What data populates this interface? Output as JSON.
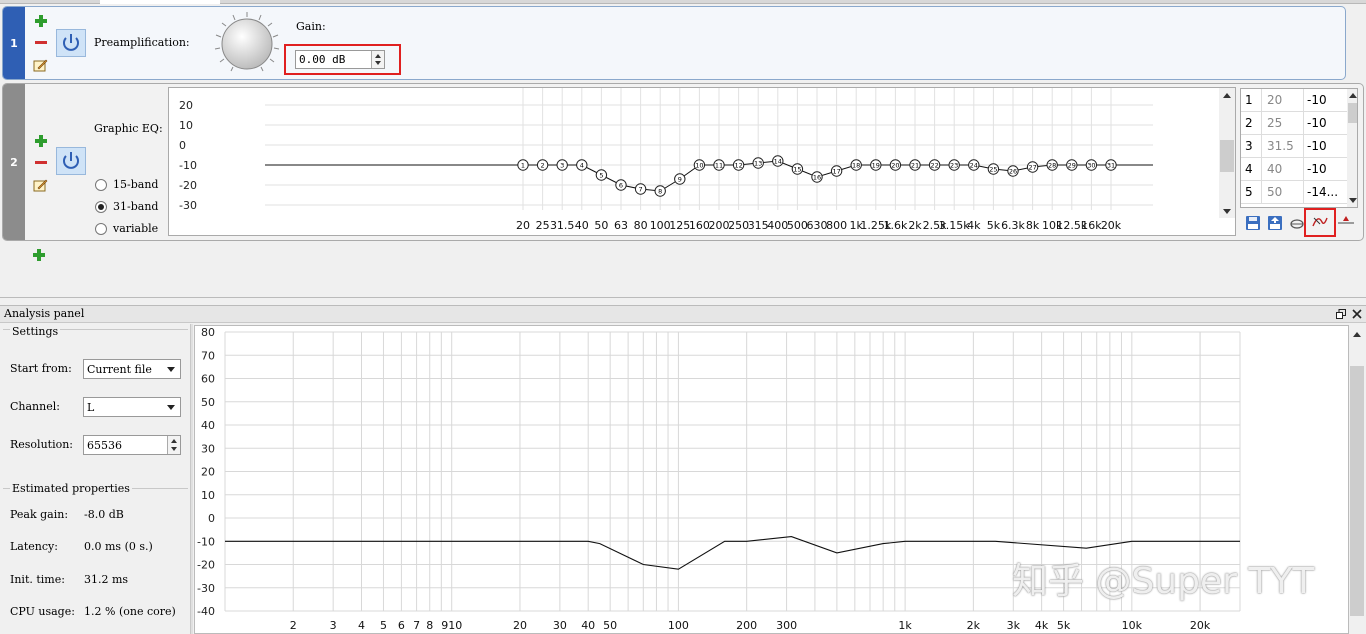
{
  "preamp": {
    "index": "1",
    "label": "Preamplification:",
    "gain_label": "Gain:",
    "gain_value": "0.00 dB"
  },
  "eq": {
    "index": "2",
    "label": "Graphic EQ:",
    "modes": [
      "15-band",
      "31-band",
      "variable"
    ],
    "selected_mode": "31-band",
    "y_ticks": [
      "20",
      "10",
      "0",
      "-10",
      "-20",
      "-30"
    ],
    "freq_labels": [
      "20",
      "25",
      "31.5",
      "40",
      "50",
      "63",
      "80",
      "100",
      "125",
      "160",
      "200",
      "250",
      "315",
      "400",
      "500",
      "630",
      "800",
      "1k",
      "1.25k",
      "1.6k",
      "2k",
      "2.5k",
      "3.15k",
      "4k",
      "5k",
      "6.3k",
      "8k",
      "10k",
      "12.5k",
      "16k",
      "20k"
    ],
    "band_gains": [
      -10,
      -10,
      -10,
      -10,
      -15,
      -20,
      -22,
      -23,
      -17,
      -10,
      -10,
      -10,
      -9,
      -8,
      -12,
      -16,
      -13,
      -10,
      -10,
      -10,
      -10,
      -10,
      -10,
      -10,
      -12,
      -13,
      -11,
      -10,
      -10,
      -10,
      -10
    ],
    "table": [
      {
        "n": "1",
        "f": "20",
        "g": "-10"
      },
      {
        "n": "2",
        "f": "25",
        "g": "-10"
      },
      {
        "n": "3",
        "f": "31.5",
        "g": "-10"
      },
      {
        "n": "4",
        "f": "40",
        "g": "-10"
      },
      {
        "n": "5",
        "f": "50",
        "g": "-14..."
      }
    ]
  },
  "analysis": {
    "title": "Analysis panel",
    "settings_title": "Settings",
    "start_from_label": "Start from:",
    "start_from_value": "Current file",
    "channel_label": "Channel:",
    "channel_value": "L",
    "resolution_label": "Resolution:",
    "resolution_value": "65536",
    "estimated_title": "Estimated properties",
    "props": [
      {
        "label": "Peak gain:",
        "value": "-8.0 dB"
      },
      {
        "label": "Latency:",
        "value": "0.0 ms (0 s.)"
      },
      {
        "label": "Init. time:",
        "value": "31.2 ms"
      },
      {
        "label": "CPU usage:",
        "value": "1.2 % (one core)"
      }
    ]
  },
  "chart_data": {
    "type": "line",
    "xscale": "log",
    "xlim": [
      1,
      30000
    ],
    "ylim": [
      -40,
      80
    ],
    "y_ticks": [
      "80",
      "70",
      "60",
      "50",
      "40",
      "30",
      "20",
      "10",
      "0",
      "-10",
      "-20",
      "-30",
      "-40"
    ],
    "x_tick_labels": [
      {
        "v": 2,
        "t": "2"
      },
      {
        "v": 3,
        "t": "3"
      },
      {
        "v": 4,
        "t": "4"
      },
      {
        "v": 5,
        "t": "5"
      },
      {
        "v": 6,
        "t": "6"
      },
      {
        "v": 7,
        "t": "7"
      },
      {
        "v": 8,
        "t": "8"
      },
      {
        "v": 10,
        "t": "910"
      },
      {
        "v": 20,
        "t": "20"
      },
      {
        "v": 30,
        "t": "30"
      },
      {
        "v": 40,
        "t": "40"
      },
      {
        "v": 50,
        "t": "50"
      },
      {
        "v": 100,
        "t": "100"
      },
      {
        "v": 200,
        "t": "200"
      },
      {
        "v": 300,
        "t": "300"
      },
      {
        "v": 1000,
        "t": "1k"
      },
      {
        "v": 2000,
        "t": "2k"
      },
      {
        "v": 3000,
        "t": "3k"
      },
      {
        "v": 4000,
        "t": "4k"
      },
      {
        "v": 5000,
        "t": "5k"
      },
      {
        "v": 10000,
        "t": "10k"
      },
      {
        "v": 20000,
        "t": "20k"
      }
    ],
    "x": [
      1,
      40,
      45,
      70,
      100,
      160,
      200,
      315,
      500,
      800,
      1000,
      2500,
      6300,
      10000,
      30000
    ],
    "y": [
      -10,
      -10,
      -11,
      -20,
      -22,
      -10,
      -10,
      -8,
      -15,
      -11,
      -10,
      -10,
      -13,
      -10,
      -10
    ],
    "grid": true
  },
  "watermark": "知乎 @Super TYT",
  "colors": {
    "accent_blue": "#2f5fb4",
    "gray_tab": "#8c8c8c",
    "highlight_red": "#e02020"
  }
}
